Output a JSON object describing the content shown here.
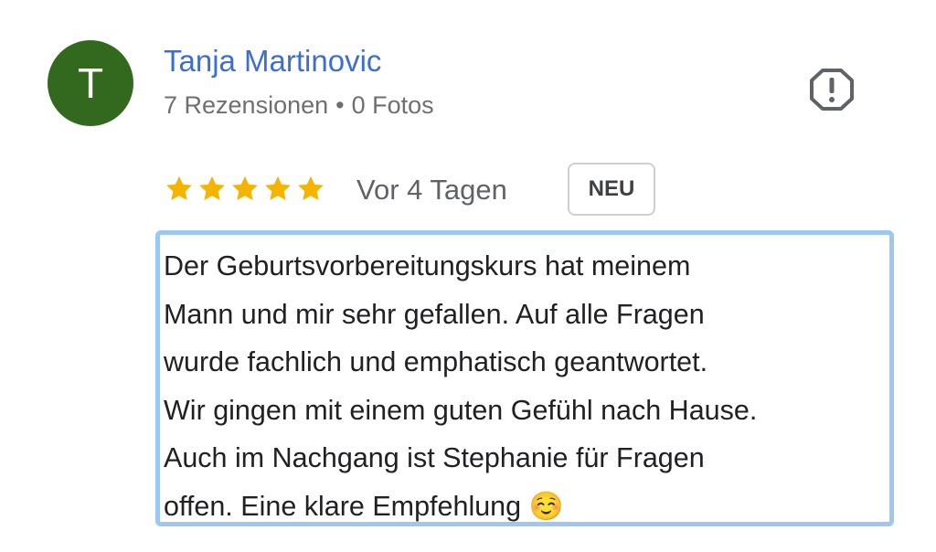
{
  "reviewer": {
    "avatar_initial": "T",
    "avatar_color": "#33691e",
    "name": "Tanja Martinovic",
    "name_color": "#3c6fd1",
    "reviews_count": "7 Rezensionen",
    "separator": "•",
    "photos_count": "0 Fotos"
  },
  "actions": {
    "report_icon": "flag-report-icon"
  },
  "review": {
    "rating": 5,
    "rating_max": 5,
    "star_color": "#f4b400",
    "date": "Vor 4 Tagen",
    "badge": "NEU",
    "text": "Der Geburtsvorbereitungskurs hat meinem\nMann und mir sehr gefallen. Auf alle Fragen\nwurde fachlich und emphatisch geantwortet.\nWir gingen mit einem guten Gefühl nach Hause.\nAuch im Nachgang ist Stephanie für Fragen\noffen. Eine klare Empfehlung ☺️",
    "highlight_color": "#9cc7f2"
  }
}
